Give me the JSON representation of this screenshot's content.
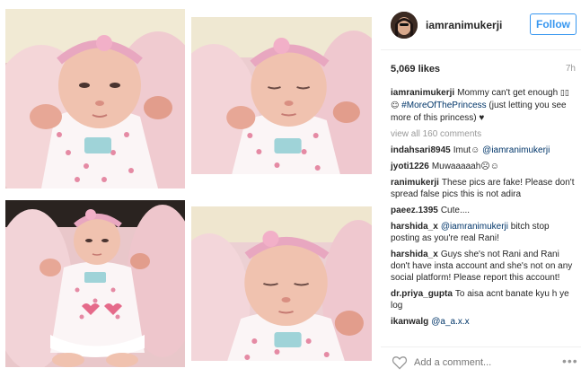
{
  "post": {
    "photos": [
      {
        "name": "baby-photo-1"
      },
      {
        "name": "baby-photo-2"
      },
      {
        "name": "baby-photo-3"
      },
      {
        "name": "baby-photo-4"
      }
    ]
  },
  "header": {
    "username": "iamranimukerji",
    "follow_label": "Follow"
  },
  "stats": {
    "likes": "5,069 likes",
    "time": "7h"
  },
  "caption": {
    "user": "iamranimukerji",
    "text_pre": "Mommy can't get enough ",
    "glyphs": "▯▯☺",
    "hashtag": "#MoreOfThePrincess",
    "text_post": " (just letting you see more of this princess) ♥"
  },
  "view_all": "view all 160 comments",
  "comments": [
    {
      "user": "indahsari8945",
      "text": "Imut☺",
      "tag": "@iamranimukerji",
      "after": ""
    },
    {
      "user": "jyoti1226",
      "text": "Muwaaaaah☹☺",
      "tag": "",
      "after": ""
    },
    {
      "user": "ranimukerji",
      "text": "These pics are fake! Please don't spread false pics this is not adira",
      "tag": "",
      "after": ""
    },
    {
      "user": "paeez.1395",
      "text": "Cute....",
      "tag": "",
      "after": ""
    },
    {
      "user": "harshida_x",
      "text": "",
      "tag": "@iamranimukerji",
      "after": " bitch stop posting as you're real Rani!"
    },
    {
      "user": "harshida_x",
      "text": "Guys she's not Rani and Rani don't have insta account and she's not on any social platform! Please report this account!",
      "tag": "",
      "after": ""
    },
    {
      "user": "dr.priya_gupta",
      "text": "To aisa acnt banate kyu h ye log",
      "tag": "",
      "after": ""
    },
    {
      "user": "ikanwalg",
      "text": "",
      "tag": "@a_a.x.x",
      "after": ""
    }
  ],
  "footer": {
    "add_comment_placeholder": "Add a comment...",
    "more_label": "•••"
  },
  "colors": {
    "link": "#003569",
    "follow": "#3897f0",
    "muted": "#999999",
    "text": "#262626"
  }
}
